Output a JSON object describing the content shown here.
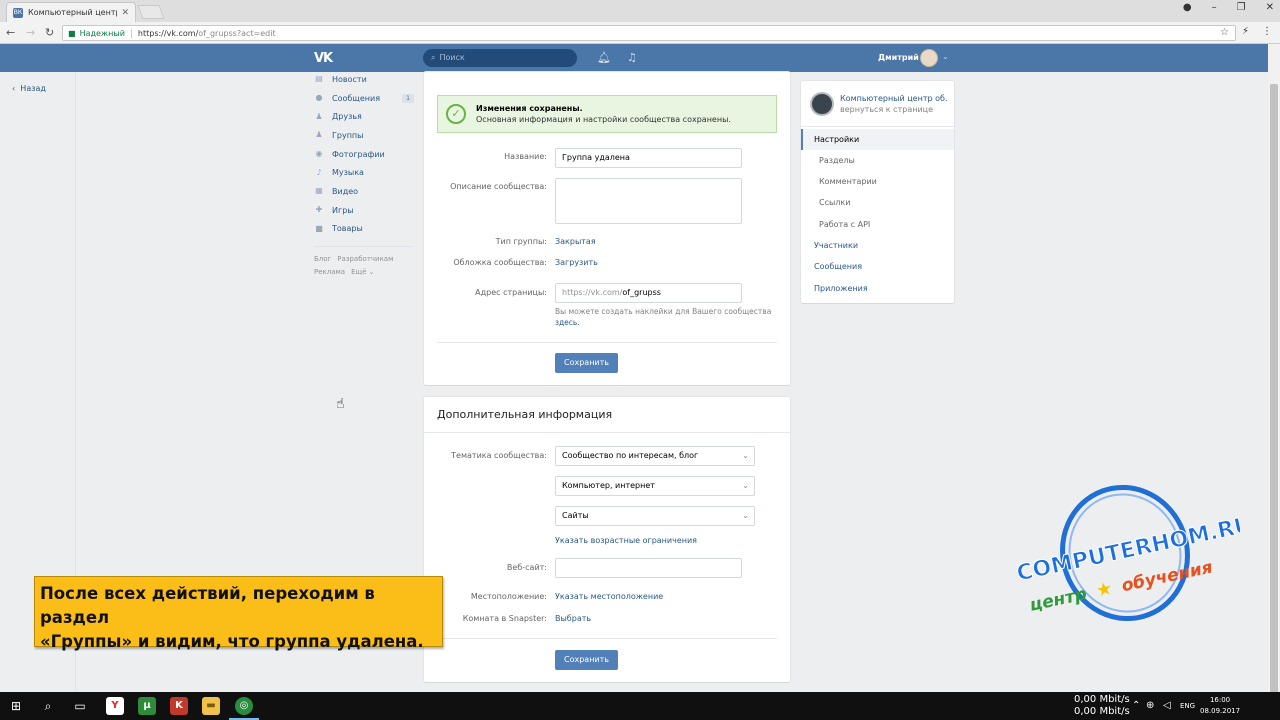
{
  "browser": {
    "tab_title": "Компьютерный центр с",
    "tab_favicon": "ВК",
    "secure_label": "Надежный",
    "url_host": "https://vk.com/",
    "url_rest": "of_grupss?act=edit"
  },
  "vk_header": {
    "logo": "VK",
    "search_placeholder": "Поиск",
    "user_name": "Дмитрий"
  },
  "back_link": "Назад",
  "left_menu": {
    "items": [
      {
        "label": "Новости",
        "icon": "newspaper-icon"
      },
      {
        "label": "Сообщения",
        "icon": "chat-icon",
        "counter": "1"
      },
      {
        "label": "Друзья",
        "icon": "person-icon"
      },
      {
        "label": "Группы",
        "icon": "people-icon"
      },
      {
        "label": "Фотографии",
        "icon": "camera-icon"
      },
      {
        "label": "Музыка",
        "icon": "music-icon"
      },
      {
        "label": "Видео",
        "icon": "film-icon"
      },
      {
        "label": "Игры",
        "icon": "gamepad-icon"
      },
      {
        "label": "Товары",
        "icon": "bag-icon"
      }
    ],
    "footer": [
      "Блог",
      "Разработчикам",
      "Реклама",
      "Ещё ⌄"
    ]
  },
  "main_form": {
    "success_title": "Изменения сохранены.",
    "success_text": "Основная информация и настройки сообщества сохранены.",
    "name_label": "Название:",
    "name_value": "Группа удалена",
    "description_label": "Описание сообщества:",
    "group_type_label": "Тип группы:",
    "group_type_value": "Закрытая",
    "cover_label": "Обложка сообщества:",
    "cover_value": "Загрузить",
    "address_label": "Адрес страницы:",
    "address_prefix": "https://vk.com/",
    "address_value": "of_grupss",
    "address_hint": "Вы можете создать наклейки для Вашего сообщества",
    "address_hint_link": "здесь.",
    "save_label": "Сохранить"
  },
  "additional": {
    "title": "Дополнительная информация",
    "topic_label": "Тематика сообщества:",
    "topic_value": "Сообщество по интересам, блог",
    "subtopic_value": "Компьютер, интернет",
    "subtopic2_value": "Сайты",
    "age_limits_link": "Указать возрастные ограничения",
    "website_label": "Веб-сайт:",
    "location_label": "Местоположение:",
    "location_value": "Указать местоположение",
    "snapster_label": "Комната в Snapster:",
    "snapster_value": "Выбрать",
    "save_label": "Сохранить"
  },
  "right_nav": {
    "community_name": "Компьютерный центр об...",
    "back_to_page": "вернуться к странице",
    "items": [
      {
        "label": "Настройки",
        "active": true,
        "sub": false
      },
      {
        "label": "Разделы",
        "active": false,
        "sub": true
      },
      {
        "label": "Комментарии",
        "active": false,
        "sub": true
      },
      {
        "label": "Ссылки",
        "active": false,
        "sub": true
      },
      {
        "label": "Работа с API",
        "active": false,
        "sub": true
      },
      {
        "label": "Участники",
        "active": false,
        "sub": false
      },
      {
        "label": "Сообщения",
        "active": false,
        "sub": false
      },
      {
        "label": "Приложения",
        "active": false,
        "sub": false
      }
    ]
  },
  "caption": {
    "line1": "После всех действий, переходим в раздел",
    "line2": "«Группы» и видим, что группа удалена."
  },
  "watermark": {
    "title": "COMPUTERHOM.RU",
    "subtitle_left": "центр",
    "subtitle_right": "обучения"
  },
  "taskbar": {
    "net_up": "0,00 Mbit/s",
    "net_down": "0,00 Mbit/s",
    "lang": "ENG",
    "time": "16:00",
    "date": "08.09.2017"
  },
  "colors": {
    "vk_blue": "#4a76a8",
    "link": "#2a5885",
    "button": "#5181b8",
    "caption_bg": "#fbbd17"
  }
}
